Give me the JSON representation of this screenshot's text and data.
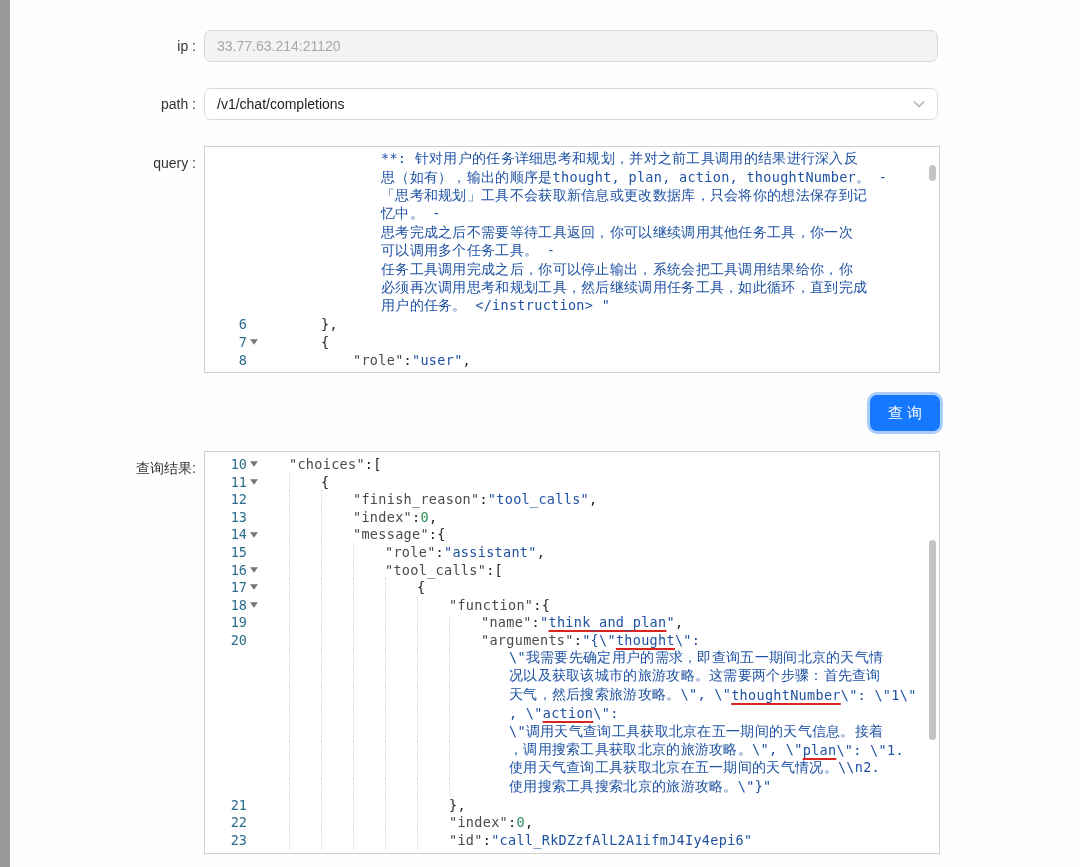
{
  "form": {
    "ip": {
      "label": "ip :",
      "value": "33.77.63.214:21120",
      "disabled": true
    },
    "path": {
      "label": "path :",
      "value": "/v1/chat/completions"
    },
    "query": {
      "label": "query :",
      "lines": [
        {
          "children": [
            {
              "continued_rows": [
                [
                  {
                    "text": "**: 针对用户的任务详细思考和规划，并对之前工具调用的结果进行深入反",
                    "kind": "str"
                  }
                ],
                [
                  {
                    "text": "思（如有），输出的顺序是thought, plan, action, thoughtNumber。 -",
                    "kind": "str"
                  }
                ],
                [
                  {
                    "text": "「思考和规划」工具不会获取新信息或更改数据库，只会将你的想法保存到记",
                    "kind": "str"
                  }
                ],
                [
                  {
                    "text": "忆中。 -",
                    "kind": "str"
                  }
                ],
                [
                  {
                    "text": "思考完成之后不需要等待工具返回，你可以继续调用其他任务工具，你一次",
                    "kind": "str"
                  }
                ],
                [
                  {
                    "text": "可以调用多个任务工具。 -",
                    "kind": "str"
                  }
                ],
                [
                  {
                    "text": "任务工具调用完成之后，你可以停止输出，系统会把工具调用结果给你，你",
                    "kind": "str"
                  }
                ],
                [
                  {
                    "text": "必须再次调用思考和规划工具，然后继续调用任务工具，如此循环，直到完成",
                    "kind": "str"
                  }
                ],
                [
                  {
                    "text": "用户的任务。 </instruction> \"",
                    "kind": "str"
                  }
                ]
              ]
            }
          ]
        },
        {
          "number": "6",
          "fold": false,
          "segments": [
            {
              "text": "},",
              "kind": "punct"
            }
          ]
        },
        {
          "number": "7",
          "fold": true,
          "segments": [
            {
              "text": "{",
              "kind": "punct"
            }
          ],
          "children": [
            {
              "number": "8",
              "fold": false,
              "segments": [
                {
                  "text": "\"role\"",
                  "kind": "key"
                },
                {
                  "text": ":",
                  "kind": "punct"
                },
                {
                  "text": "\"user\"",
                  "kind": "str"
                },
                {
                  "text": ",",
                  "kind": "punct"
                }
              ]
            }
          ]
        }
      ]
    }
  },
  "query_button": {
    "label": "查 询"
  },
  "result": {
    "label": "查询结果:",
    "lines": [
      {
        "number": "10",
        "fold": true,
        "segments": [
          {
            "text": "\"choices\"",
            "kind": "key"
          },
          {
            "text": ":[",
            "kind": "punct"
          }
        ],
        "children": [
          {
            "number": "11",
            "fold": true,
            "segments": [
              {
                "text": "{",
                "kind": "punct"
              }
            ],
            "children": [
              {
                "number": "12",
                "fold": false,
                "segments": [
                  {
                    "text": "\"finish_reason\"",
                    "kind": "key"
                  },
                  {
                    "text": ":",
                    "kind": "punct"
                  },
                  {
                    "text": "\"tool_calls\"",
                    "kind": "str"
                  },
                  {
                    "text": ",",
                    "kind": "punct"
                  }
                ]
              },
              {
                "number": "13",
                "fold": false,
                "segments": [
                  {
                    "text": "\"index\"",
                    "kind": "key"
                  },
                  {
                    "text": ":",
                    "kind": "punct"
                  },
                  {
                    "text": "0",
                    "kind": "num"
                  },
                  {
                    "text": ",",
                    "kind": "punct"
                  }
                ]
              },
              {
                "number": "14",
                "fold": true,
                "segments": [
                  {
                    "text": "\"message\"",
                    "kind": "key"
                  },
                  {
                    "text": ":{",
                    "kind": "punct"
                  }
                ],
                "children": [
                  {
                    "number": "15",
                    "fold": false,
                    "segments": [
                      {
                        "text": "\"role\"",
                        "kind": "key"
                      },
                      {
                        "text": ":",
                        "kind": "punct"
                      },
                      {
                        "text": "\"assistant\"",
                        "kind": "str"
                      },
                      {
                        "text": ",",
                        "kind": "punct"
                      }
                    ]
                  },
                  {
                    "number": "16",
                    "fold": true,
                    "segments": [
                      {
                        "text": "\"tool_calls\"",
                        "kind": "key"
                      },
                      {
                        "text": ":[",
                        "kind": "punct"
                      }
                    ],
                    "children": [
                      {
                        "number": "17",
                        "fold": true,
                        "segments": [
                          {
                            "text": "{",
                            "kind": "punct"
                          }
                        ],
                        "children": [
                          {
                            "number": "18",
                            "fold": true,
                            "segments": [
                              {
                                "text": "\"function\"",
                                "kind": "key"
                              },
                              {
                                "text": ":{",
                                "kind": "punct"
                              }
                            ],
                            "children": [
                              {
                                "number": "19",
                                "fold": false,
                                "segments": [
                                  {
                                    "text": "\"name\"",
                                    "kind": "key"
                                  },
                                  {
                                    "text": ":",
                                    "kind": "punct"
                                  },
                                  {
                                    "text": "\"",
                                    "kind": "str"
                                  },
                                  {
                                    "text": "think_and_plan",
                                    "kind": "str",
                                    "underlined": true
                                  },
                                  {
                                    "text": "\"",
                                    "kind": "str"
                                  },
                                  {
                                    "text": ",",
                                    "kind": "punct"
                                  }
                                ]
                              },
                              {
                                "number": "20",
                                "fold": false,
                                "segments": [
                                  {
                                    "text": "\"arguments\"",
                                    "kind": "key"
                                  },
                                  {
                                    "text": ":",
                                    "kind": "punct"
                                  },
                                  {
                                    "text": "\"{\\\"",
                                    "kind": "str"
                                  },
                                  {
                                    "text": "thought",
                                    "kind": "str",
                                    "underlined": true
                                  },
                                  {
                                    "text": "\\\":",
                                    "kind": "str"
                                  }
                                ],
                                "continued_rows": [
                                  [
                                    {
                                      "text": "\\\"我需要先确定用户的需求，即查询五一期间北京的天气情",
                                      "kind": "str"
                                    }
                                  ],
                                  [
                                    {
                                      "text": "况以及获取该城市的旅游攻略。这需要两个步骤：首先查询",
                                      "kind": "str"
                                    }
                                  ],
                                  [
                                    {
                                      "text": "天气，然后搜索旅游攻略。\\\", \\\"",
                                      "kind": "str"
                                    },
                                    {
                                      "text": "thoughtNumber",
                                      "kind": "str",
                                      "underlined": true
                                    },
                                    {
                                      "text": "\\\": \\\"1\\\"",
                                      "kind": "str"
                                    }
                                  ],
                                  [
                                    {
                                      "text": ", \\\"",
                                      "kind": "str"
                                    },
                                    {
                                      "text": "action",
                                      "kind": "str",
                                      "underlined": true
                                    },
                                    {
                                      "text": "\\\":",
                                      "kind": "str"
                                    }
                                  ],
                                  [
                                    {
                                      "text": "\\\"调用天气查询工具获取北京在五一期间的天气信息。接着",
                                      "kind": "str"
                                    }
                                  ],
                                  [
                                    {
                                      "text": "，调用搜索工具获取北京的旅游攻略。\\\", \\\"",
                                      "kind": "str"
                                    },
                                    {
                                      "text": "plan",
                                      "kind": "str",
                                      "underlined": true
                                    },
                                    {
                                      "text": "\\\": \\\"1.",
                                      "kind": "str"
                                    }
                                  ],
                                  [
                                    {
                                      "text": "使用天气查询工具获取北京在五一期间的天气情况。\\\\n2.",
                                      "kind": "str"
                                    }
                                  ],
                                  [
                                    {
                                      "text": "使用搜索工具搜索北京的旅游攻略。\\\"}\"",
                                      "kind": "str"
                                    }
                                  ]
                                ]
                              }
                            ]
                          },
                          {
                            "number": "21",
                            "fold": false,
                            "segments": [
                              {
                                "text": "},",
                                "kind": "punct"
                              }
                            ]
                          },
                          {
                            "number": "22",
                            "fold": false,
                            "segments": [
                              {
                                "text": "\"index\"",
                                "kind": "key"
                              },
                              {
                                "text": ":",
                                "kind": "punct"
                              },
                              {
                                "text": "0",
                                "kind": "num"
                              },
                              {
                                "text": ",",
                                "kind": "punct"
                              }
                            ]
                          },
                          {
                            "number": "23",
                            "fold": false,
                            "segments": [
                              {
                                "text": "\"id\"",
                                "kind": "key"
                              },
                              {
                                "text": ":",
                                "kind": "punct"
                              },
                              {
                                "text": "\"call_RkDZzfAlL2A1ifmJ4Iy4epi6\"",
                                "kind": "str"
                              }
                            ]
                          }
                        ]
                      }
                    ]
                  }
                ]
              }
            ]
          }
        ]
      }
    ]
  }
}
